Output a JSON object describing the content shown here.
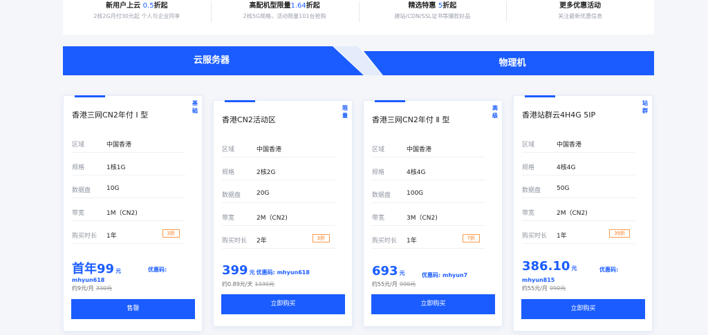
{
  "promo": [
    {
      "title_pre": "新用户上云 ",
      "title_hl": "0.5",
      "title_post": "折起",
      "sub": "2核2G月付30元起 个人与企业同享"
    },
    {
      "title_pre": "高配机型限量",
      "title_hl": "1.64",
      "title_post": "折起",
      "sub": "2核5G规格，活动限量101台抢购"
    },
    {
      "title_pre": "精选特惠 ",
      "title_hl": "5",
      "title_post": "折起",
      "sub": "建站/CDN/SSL证书等爆款好品"
    },
    {
      "title_pre": "更多优惠活动",
      "title_hl": "",
      "title_post": "",
      "sub": "关注最新优惠信息"
    }
  ],
  "tabs": {
    "cloud": "云服务器",
    "physical": "物理机"
  },
  "spec_labels": {
    "region": "区域",
    "spec": "规格",
    "disk": "数据盘",
    "bandwidth": "带宽",
    "term": "购买时长"
  },
  "coupon_label": "优惠码:",
  "cards": [
    {
      "badge": "基础",
      "title": "香港三网CN2年付 Ⅰ 型",
      "region": "中国香港",
      "spec": "1核1G",
      "disk": "10G",
      "bandwidth": "1M（CN2)",
      "term": "1年",
      "discount": "3折",
      "price": "首年99",
      "unit": "元",
      "coupon": "mhyun618",
      "sub": "约9元/月",
      "orig": "330元",
      "button": "售罄"
    },
    {
      "badge": "限量",
      "title": "香港CN2活动区",
      "region": "中国香港",
      "spec": "2核2G",
      "disk": "20G",
      "bandwidth": "2M（CN2)",
      "term": "2年",
      "discount": "3折",
      "price": "399",
      "unit": "元",
      "coupon": "mhyun618",
      "sub": "约0.89元/天",
      "orig": "1330元",
      "button": "立即购买"
    },
    {
      "badge": "高级",
      "title": "香港三网CN2年付 Ⅱ 型",
      "region": "中国香港",
      "spec": "4核4G",
      "disk": "100G",
      "bandwidth": "3M（CN2)",
      "term": "1年",
      "discount": "7折",
      "price": "693",
      "unit": "元",
      "coupon": "mhyun7",
      "sub": "约55元/月",
      "orig": "990元",
      "button": "立即购买"
    },
    {
      "badge": "站群",
      "title": "香港站群云4H4G 5IP",
      "region": "中国香港",
      "spec": "4核4G",
      "disk": "50G",
      "bandwidth": "2M（CN2)",
      "term": "1年",
      "discount": "39折",
      "price": "386.10",
      "unit": "元",
      "coupon": "mhyun815",
      "sub": "约55元/月",
      "orig": "990元",
      "button": "立即购买"
    }
  ],
  "colors": {
    "brand": "#1a5cff",
    "discount": "#ff7a1a"
  }
}
